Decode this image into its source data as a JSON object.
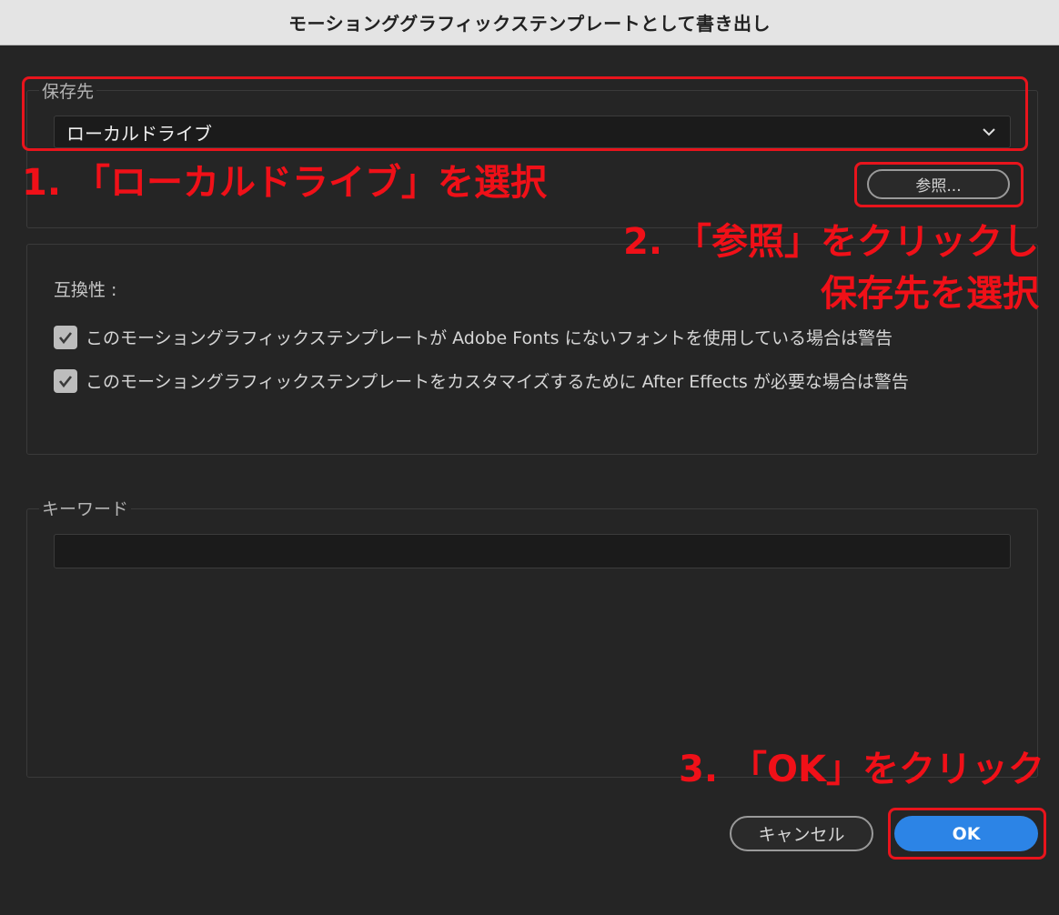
{
  "window": {
    "title": "モーションググラフィックステンプレートとして書き出し"
  },
  "destination": {
    "legend": "保存先",
    "selected": "ローカルドライブ",
    "browse_label": "参照..."
  },
  "compatibility": {
    "label": "互換性 :",
    "options": [
      {
        "text": "このモーショングラフィックステンプレートが Adobe Fonts にないフォントを使用している場合は警告",
        "checked": true
      },
      {
        "text": "このモーショングラフィックステンプレートをカスタマイズするために After Effects が必要な場合は警告",
        "checked": true
      }
    ]
  },
  "keywords": {
    "legend": "キーワード",
    "value": ""
  },
  "footer": {
    "cancel_label": "キャンセル",
    "ok_label": "OK"
  },
  "annotations": {
    "step1": "1. 「ローカルドライブ」を選択",
    "step2_line1": "2. 「参照」をクリックし",
    "step2_line2": "保存先を選択",
    "step3": "3. 「OK」をクリック"
  },
  "colors": {
    "annotation": "#e8141c",
    "ok_button": "#2c84e6",
    "background": "#252525"
  }
}
